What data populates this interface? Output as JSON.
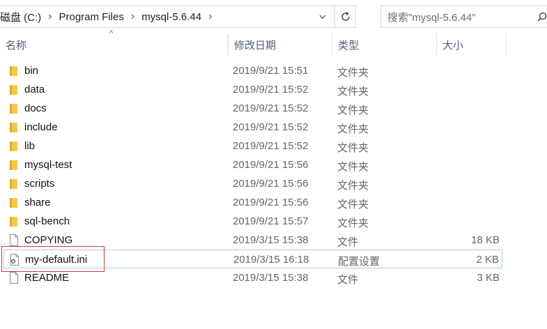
{
  "address": {
    "crumbs": [
      "磁盘 (C:)",
      "Program Files",
      "mysql-5.6.44"
    ]
  },
  "search": {
    "placeholder": "搜索\"mysql-5.6.44\""
  },
  "columns": {
    "name": "名称",
    "date": "修改日期",
    "type": "类型",
    "size": "大小"
  },
  "colors": {
    "folder": "#f2c94c",
    "selection_border": "#99d1ff",
    "annotation": "#d9383a",
    "header_text": "#4c607a"
  },
  "files": [
    {
      "name": "bin",
      "date": "2019/9/21 15:51",
      "type": "文件夹",
      "size": "",
      "icon": "folder-icon"
    },
    {
      "name": "data",
      "date": "2019/9/21 15:52",
      "type": "文件夹",
      "size": "",
      "icon": "folder-icon"
    },
    {
      "name": "docs",
      "date": "2019/9/21 15:52",
      "type": "文件夹",
      "size": "",
      "icon": "folder-icon"
    },
    {
      "name": "include",
      "date": "2019/9/21 15:52",
      "type": "文件夹",
      "size": "",
      "icon": "folder-icon"
    },
    {
      "name": "lib",
      "date": "2019/9/21 15:52",
      "type": "文件夹",
      "size": "",
      "icon": "folder-icon"
    },
    {
      "name": "mysql-test",
      "date": "2019/9/21 15:56",
      "type": "文件夹",
      "size": "",
      "icon": "folder-icon"
    },
    {
      "name": "scripts",
      "date": "2019/9/21 15:56",
      "type": "文件夹",
      "size": "",
      "icon": "folder-icon"
    },
    {
      "name": "share",
      "date": "2019/9/21 15:56",
      "type": "文件夹",
      "size": "",
      "icon": "folder-icon"
    },
    {
      "name": "sql-bench",
      "date": "2019/9/21 15:57",
      "type": "文件夹",
      "size": "",
      "icon": "folder-icon"
    },
    {
      "name": "COPYING",
      "date": "2019/3/15 15:38",
      "type": "文件",
      "size": "18 KB",
      "icon": "file-icon"
    },
    {
      "name": "my-default.ini",
      "date": "2019/3/15 16:18",
      "type": "配置设置",
      "size": "2 KB",
      "icon": "settings-file-icon"
    },
    {
      "name": "README",
      "date": "2019/3/15 15:38",
      "type": "文件",
      "size": "3 KB",
      "icon": "file-icon"
    }
  ]
}
